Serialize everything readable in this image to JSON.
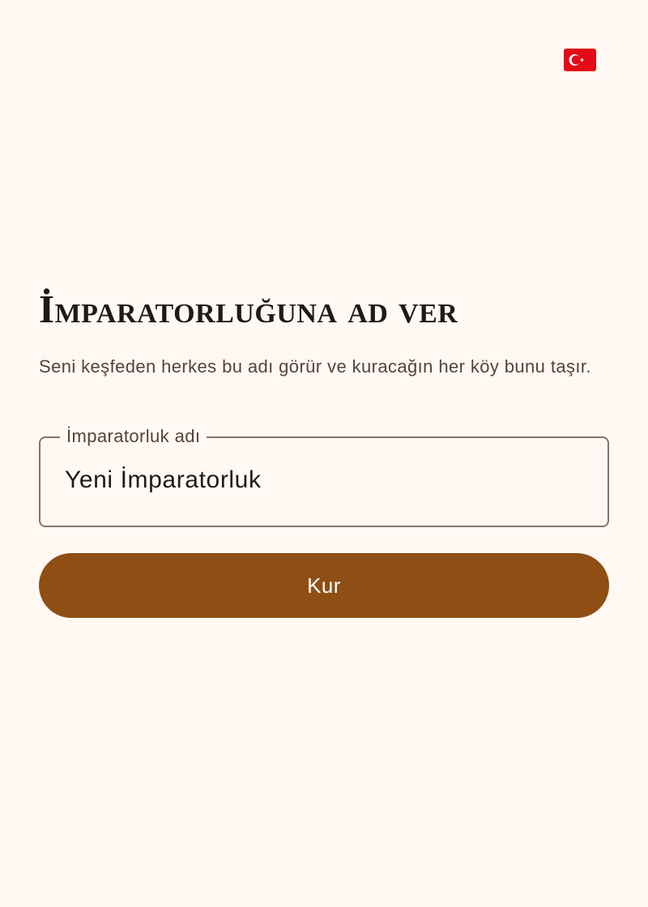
{
  "language": {
    "flag_icon": "turkey-flag-icon",
    "flag_color": "#e30a17"
  },
  "main": {
    "title": "İmparatorluğuna ad ver",
    "subtitle": "Seni keşfeden herkes bu adı görür ve kuracağın her köy bunu taşır.",
    "name_field": {
      "label": "İmparatorluk adı",
      "value": "Yeni İmparatorluk"
    },
    "submit_label": "Kur"
  },
  "colors": {
    "background": "#fff8f3",
    "primary": "#8f4f14",
    "on_primary": "#ffffff",
    "text": "#201a17",
    "text_muted": "#52443c",
    "outline": "#85736a"
  }
}
